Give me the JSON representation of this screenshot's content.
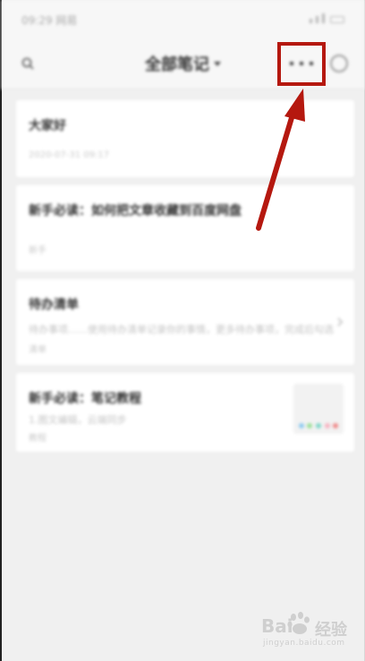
{
  "status_bar": {
    "time": "09:29 网易",
    "indicators": "✻ ⁿ ᵢₗ ᵢₗ"
  },
  "header": {
    "title": "全部笔记",
    "search_icon": "search-icon",
    "more_icon": "more-horizontal-icon",
    "profile_icon": "profile-icon"
  },
  "notes": [
    {
      "title": "大家好",
      "snippet": "",
      "meta": "2020-07-31 09:17"
    },
    {
      "title": "新手必读：如何把文章收藏到百度网盘",
      "snippet": "",
      "meta": "新手"
    },
    {
      "title": "待办清单",
      "snippet": "待办事项……使用待办清单记录你的事情，更多待办事项，完成后勾选",
      "meta": "清单"
    },
    {
      "title": "新手必读：笔记教程",
      "snippet": "1.图文编辑，云端同步",
      "meta": "教程"
    }
  ],
  "thumbnail_colors": [
    "#8ecbf0",
    "#9be09a",
    "#7fd6c8",
    "#f7b4c2",
    "#f08a8a"
  ],
  "annotation": {
    "color": "#b5180f"
  },
  "watermark": {
    "brand_left": "Bai",
    "brand_right": "经验",
    "url": "jingyan.baidu.com"
  }
}
